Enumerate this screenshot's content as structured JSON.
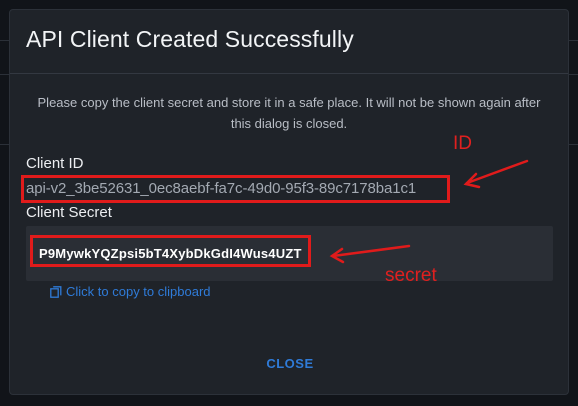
{
  "dialog": {
    "title": "API Client Created Successfully",
    "info": "Please copy the client secret and store it in a safe place. It will not be shown again after this dialog is closed.",
    "client_id_label": "Client ID",
    "client_id_value": "api-v2_3be52631_0ec8aebf-fa7c-49d0-95f3-89c7178ba1c1",
    "client_secret_label": "Client Secret",
    "client_secret_value": "P9MywkYQZpsi5bT4XybDkGdI4Wus4UZT",
    "copy_link_label": "Click to copy to clipboard",
    "copy_icon": "copy-icon",
    "close_label": "CLOSE"
  },
  "annotations": {
    "id_label": "ID",
    "secret_label": "secret",
    "color": "#e01b1b"
  },
  "colors": {
    "accent": "#2f7bd8",
    "dialog_bg": "#1f2329",
    "page_bg": "#111419"
  }
}
